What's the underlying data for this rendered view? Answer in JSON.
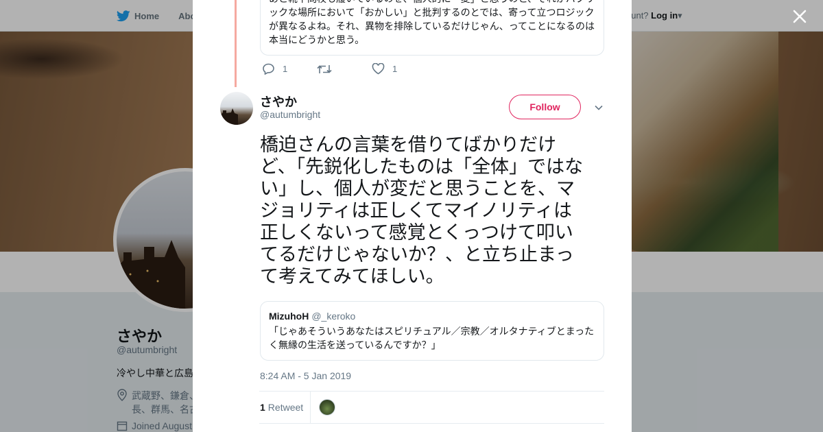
{
  "nav": {
    "home": "Home",
    "about": "Abo",
    "account_prompt": "ccount?",
    "login": "Log in"
  },
  "profile": {
    "name": "さやか",
    "handle": "@autumbright",
    "bio": "冷やし中華と広島",
    "location": "武蔵野、鎌倉、\n長、群馬、名古",
    "joined": "Joined August"
  },
  "modal": {
    "previous_tweet": {
      "quote_text": "あと靴下問校も履いているのを、個人的に「変」と思うのと、それがパブリックな場所において「おかしい」と批判するのとでは、寄って立つロジックが異なるよね。それ、異物を排除しているだけじゃん、ってことになるのは本当にどうかと思う。",
      "reply_count": "1",
      "retweet_count": "",
      "like_count": "1"
    },
    "tweet": {
      "name": "さやか",
      "handle": "@autumbright",
      "follow_label": "Follow",
      "text": "橋迫さんの言葉を借りてばかりだけど、「先鋭化したものは「全体」ではない」し、個人が変だと思うことを、マジョリティは正しくてマイノリティは正しくないって感覚とくっつけて叩いてるだけじゃないか？、と立ち止まって考えてみてほしい。",
      "quote": {
        "name": "MizuhoH",
        "handle": "@_keroko",
        "text": "「じゃあそういうあなたはスピリチュアル／宗教／オルタナティブとまったく無縁の生活を送っているんですか？」"
      },
      "timestamp": "8:24 AM - 5 Jan 2019",
      "retweet_count": "1",
      "retweet_label": "Retweet"
    }
  },
  "colors": {
    "accent": "#e0245e",
    "twitter_blue": "#1da1f2",
    "thread_line": "#f5a9a0",
    "secondary_text": "#657786"
  }
}
